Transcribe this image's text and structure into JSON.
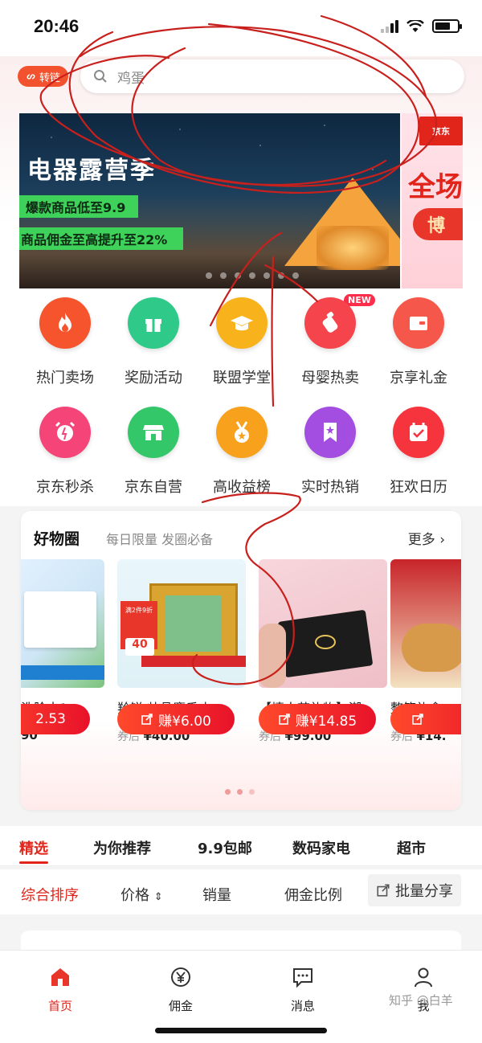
{
  "status_bar": {
    "time": "20:46"
  },
  "header": {
    "link_button_label": "转链",
    "search_placeholder": "鸡蛋"
  },
  "banner": {
    "title": "电器露营季",
    "tag1": "爆款商品低至9.9",
    "tag2": "商品佣金至高提升至22%",
    "next_logo": "京东",
    "next_big": "全场",
    "next_pill": "博"
  },
  "grid": {
    "new_badge": "NEW",
    "items": [
      {
        "label": "热门卖场",
        "icon": "fire-icon",
        "color": "#f5542c"
      },
      {
        "label": "奖励活动",
        "icon": "gift-icon",
        "color": "#2fc98a"
      },
      {
        "label": "联盟学堂",
        "icon": "graduation-cap-icon",
        "color": "#f7b21c"
      },
      {
        "label": "母婴热卖",
        "icon": "baby-bottle-icon",
        "color": "#f5444b"
      },
      {
        "label": "京享礼金",
        "icon": "wallet-icon",
        "color": "#f5584a"
      },
      {
        "label": "京东秒杀",
        "icon": "alarm-clock-icon",
        "color": "#f54478"
      },
      {
        "label": "京东自营",
        "icon": "store-icon",
        "color": "#34c76a"
      },
      {
        "label": "高收益榜",
        "icon": "medal-icon",
        "color": "#f7a11c"
      },
      {
        "label": "实时热销",
        "icon": "bookmark-star-icon",
        "color": "#a34ee0"
      },
      {
        "label": "狂欢日历",
        "icon": "calendar-check-icon",
        "color": "#f5343e"
      }
    ]
  },
  "goods": {
    "title": "好物圈",
    "subtitle": "每日限量 发圈必备",
    "more": "更多",
    "products": [
      {
        "name": "洗脸巾1...",
        "price_prefix": "",
        "price": "90",
        "earn": "2.53"
      },
      {
        "name": "羚锐 壮骨麝香止...",
        "price_prefix": "券后",
        "price": "¥40.00",
        "earn": "赚¥6.00"
      },
      {
        "name": "【情人节礼物】潮...",
        "price_prefix": "券后",
        "price": "¥99.00",
        "earn": "赚¥14.85"
      },
      {
        "name": "整箱礼盒...",
        "price_prefix": "券后",
        "price": "¥14.",
        "earn": ""
      }
    ],
    "promo_tag": "满2件9折",
    "promo_price": "40"
  },
  "tabs": [
    "精选",
    "为你推荐",
    "9.9包邮",
    "数码家电",
    "超市"
  ],
  "sort": {
    "items": [
      "综合排序",
      "价格",
      "销量",
      "佣金比例"
    ],
    "batch_share": "批量分享"
  },
  "bottom_nav": [
    {
      "label": "首页",
      "icon": "home-icon"
    },
    {
      "label": "佣金",
      "icon": "yen-coin-icon"
    },
    {
      "label": "消息",
      "icon": "message-icon"
    },
    {
      "label": "我",
      "icon": "person-icon"
    }
  ],
  "watermark": "知乎 @白羊",
  "colors": {
    "brand_red": "#e1251b",
    "accent_orange": "#f2522d",
    "green_tag": "#3fd25a"
  }
}
